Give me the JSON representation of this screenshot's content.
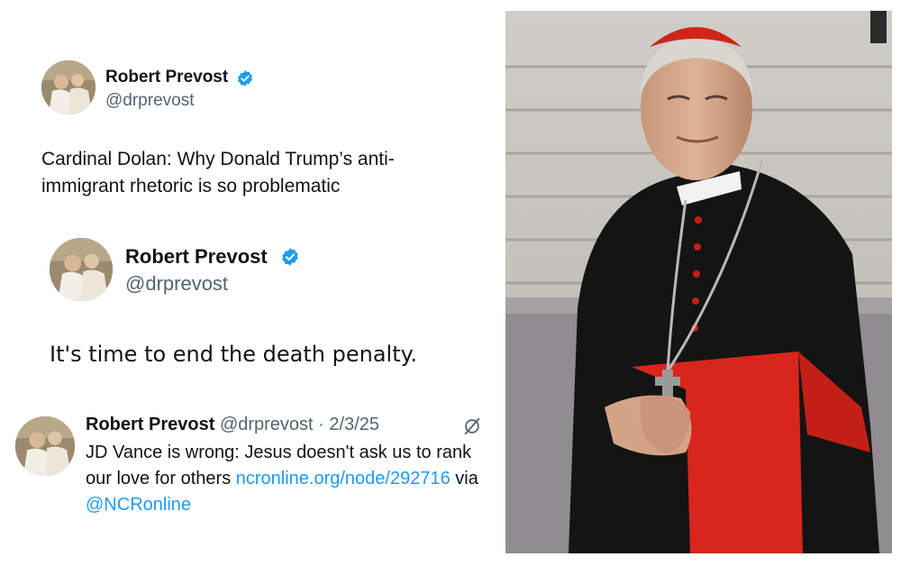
{
  "tweet1": {
    "name": "Robert Prevost",
    "handle": "@drprevost",
    "text": "Cardinal Dolan: Why Donald Trump’s anti-immigrant rhetoric is so problematic"
  },
  "tweet2": {
    "name": "Robert Prevost",
    "handle": "@drprevost",
    "text": "It's time to end the death penalty."
  },
  "tweet3": {
    "name": "Robert Prevost",
    "handle": "@drprevost",
    "date": "· 2/3/25",
    "text_start": "JD Vance is wrong: Jesus doesn't ask us to rank our love for others ",
    "link1": "ncronline.org/node/292716",
    "via": " via ",
    "link2": "@NCRonline"
  },
  "colors": {
    "verified": "#1d9bf0",
    "link": "#1d9bf0",
    "cassock": "#141414",
    "sash": "#d8261c"
  },
  "icons": [
    "verified-badge-icon",
    "grok-icon"
  ]
}
